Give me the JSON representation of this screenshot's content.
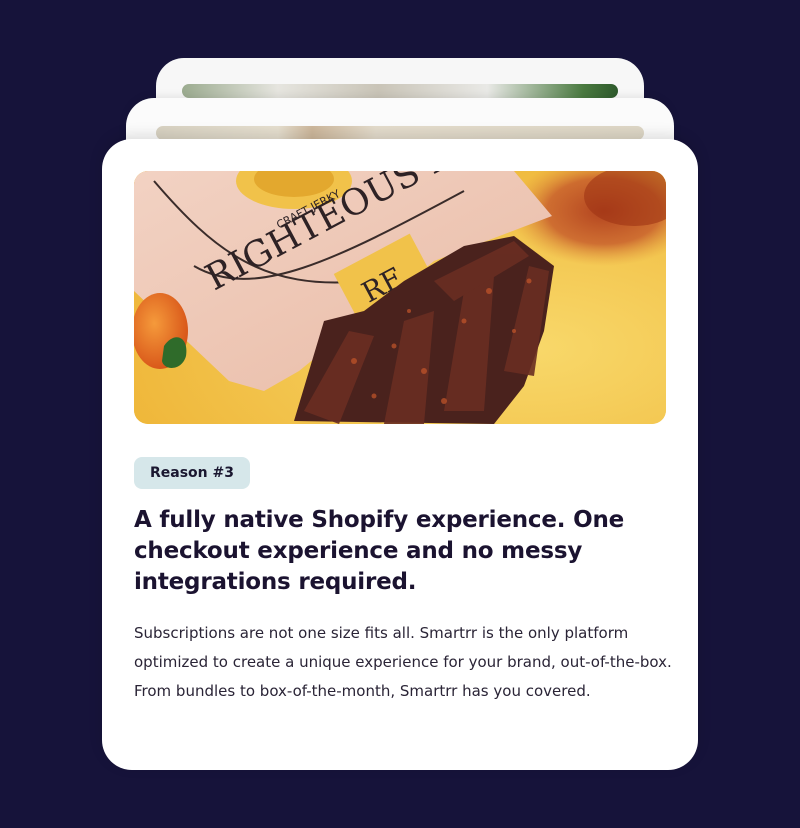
{
  "card": {
    "badge": "Reason #3",
    "headline": "A fully native Shopify experience. One checkout experience and no messy integrations required.",
    "body": "Subscriptions are not one size fits all. Smartrr is the only platform optimized to create a unique experience for your brand, out-of-the-box. From bundles to box-of-the-month, Smartrr has you covered."
  },
  "image": {
    "package_text": "RIGHTEOUS FELON",
    "package_subtext": "CRAFT JERKY",
    "logo": "RF"
  },
  "colors": {
    "background": "#16133a",
    "card": "#ffffff",
    "badge_bg": "#d6e7ea",
    "headline": "#1b1330",
    "body": "#2a2436",
    "image_bg": "#f4c952"
  },
  "icons": {
    "hero_image": "jerky-photo"
  }
}
